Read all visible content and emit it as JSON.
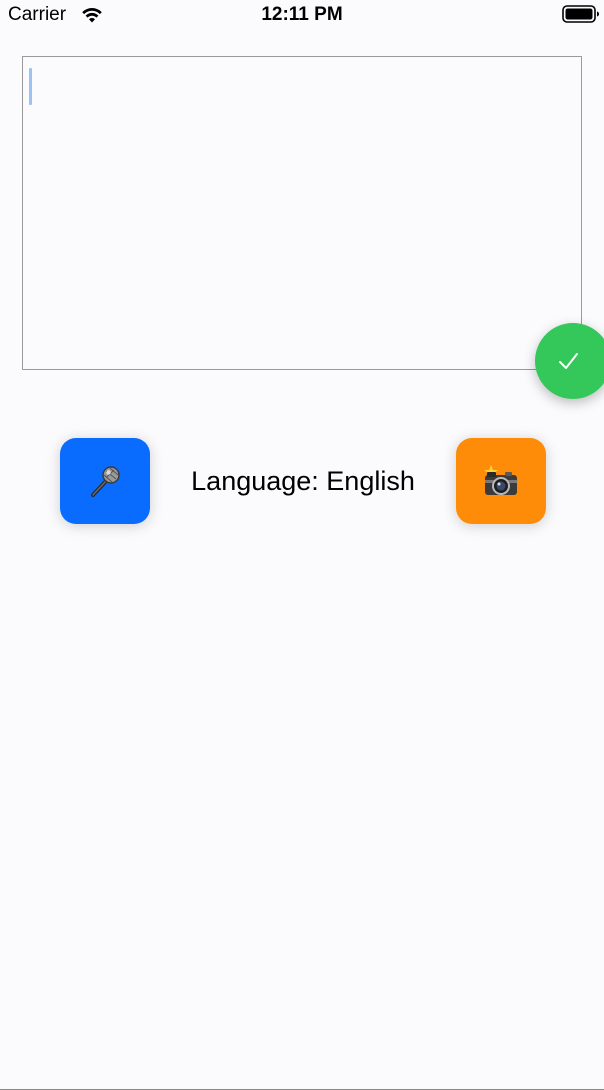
{
  "status_bar": {
    "carrier": "Carrier",
    "time": "12:11 PM",
    "wifi_icon": "wifi-icon",
    "battery_icon": "battery-icon"
  },
  "editor": {
    "value": "",
    "placeholder": ""
  },
  "confirm_button": {
    "icon": "checkmark-icon",
    "color": "#34c759"
  },
  "actions": {
    "mic_icon": "microphone-icon",
    "mic_color": "#0a6cff",
    "camera_icon": "camera-flash-icon",
    "camera_color": "#ff8c08",
    "language_label": "Language: English"
  }
}
